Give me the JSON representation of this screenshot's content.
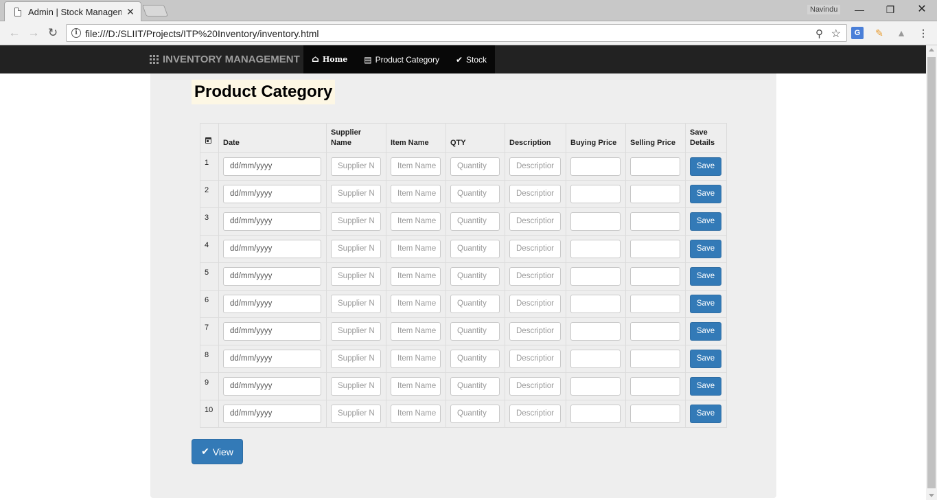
{
  "browser": {
    "tab_title": "Admin | Stock Manageme",
    "profile_name": "Navindu",
    "url": "file:///D:/SLIIT/Projects/ITP%20Inventory/inventory.html",
    "icons": {
      "back": "back-arrow",
      "forward": "forward-arrow",
      "reload": "reload",
      "zoom": "magnifier",
      "bookmark": "star",
      "ext_translate": "google-translate",
      "ext_pencil": "pencil",
      "ext_drive": "google-drive",
      "menu": "kebab-menu"
    }
  },
  "navbar": {
    "brand": "INVENTORY MANAGEMENT",
    "links": [
      {
        "label": "Home",
        "icon": "home"
      },
      {
        "label": "Product Category",
        "icon": "list-alt"
      },
      {
        "label": "Stock",
        "icon": "check"
      }
    ]
  },
  "page": {
    "title": "Product Category",
    "view_button": "View"
  },
  "table": {
    "headers": {
      "date": "Date",
      "supplier": "Supplier Name",
      "item": "Item Name",
      "qty": "QTY",
      "description": "Description",
      "buying": "Buying Price",
      "selling": "Selling Price",
      "save": "Save Details"
    },
    "placeholders": {
      "date": "dd/mm/yyyy",
      "supplier": "Supplier N",
      "item": "Item Name",
      "qty": "Quantity",
      "description": "Descriptior"
    },
    "save_label": "Save",
    "rows": [
      "1",
      "2",
      "3",
      "4",
      "5",
      "6",
      "7",
      "8",
      "9",
      "10"
    ]
  },
  "colors": {
    "navbar_bg": "#222222",
    "primary_button": "#337ab7",
    "panel_bg": "#eeeeee",
    "title_highlight": "#fdf7e4"
  }
}
